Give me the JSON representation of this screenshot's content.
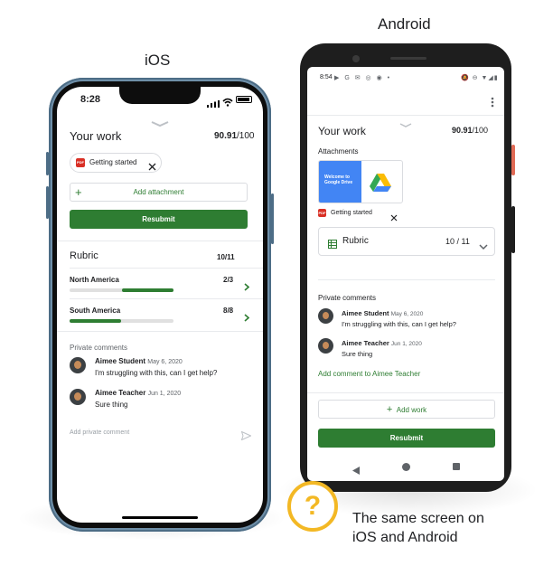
{
  "labels": {
    "ios": "iOS",
    "android": "Android",
    "caption_line1": "The same screen on",
    "caption_line2": "iOS and Android",
    "help_glyph": "?"
  },
  "icons": {
    "help": "question-mark-icon",
    "close": "close-icon",
    "add": "plus-icon",
    "chevron": "chevron-right-icon",
    "send": "send-icon",
    "drive": "google-drive-icon",
    "rubric": "rubric-table-icon"
  },
  "colors": {
    "accent_green": "#2e7d32",
    "help_yellow": "#f3b824",
    "pdf_red": "#d93025",
    "drive_blue": "#4285f4"
  },
  "ios": {
    "status_time": "8:28",
    "title": "Your work",
    "grade": "90.91",
    "grade_total": "/100",
    "attachment_name": "Getting started",
    "pdf_label": "PDF",
    "add_attachment": "Add attachment",
    "resubmit": "Resubmit",
    "rubric_title": "Rubric",
    "rubric_score": "10/11",
    "criteria": [
      {
        "name": "North America",
        "score": "2/3",
        "progress": 0.67
      },
      {
        "name": "South America",
        "score": "8/8",
        "progress": 1.0
      }
    ],
    "private_comments_title": "Private comments",
    "comments": [
      {
        "author": "Aimee Student",
        "date": "May 6, 2020",
        "text": "I'm struggling with this, can I get help?"
      },
      {
        "author": "Aimee Teacher",
        "date": "Jun 1, 2020",
        "text": "Sure thing"
      }
    ],
    "add_comment_placeholder": "Add private comment"
  },
  "android": {
    "status_time": "8:54",
    "title": "Your work",
    "grade": "90.91",
    "grade_total": "/100",
    "attachments_title": "Attachments",
    "thumb_title_line1": "Welcome to",
    "thumb_title_line2": "Google Drive",
    "attachment_name": "Getting started",
    "pdf_label": "PDF",
    "rubric_title": "Rubric",
    "rubric_score": "10 / 11",
    "private_comments_title": "Private comments",
    "comments": [
      {
        "author": "Aimee Student",
        "date": "May 6, 2020",
        "text": "I'm struggling with this, can I get help?"
      },
      {
        "author": "Aimee Teacher",
        "date": "Jun 1, 2020",
        "text": "Sure thing"
      }
    ],
    "add_comment_link": "Add comment to Aimee Teacher",
    "add_work": "Add work",
    "resubmit": "Resubmit"
  }
}
